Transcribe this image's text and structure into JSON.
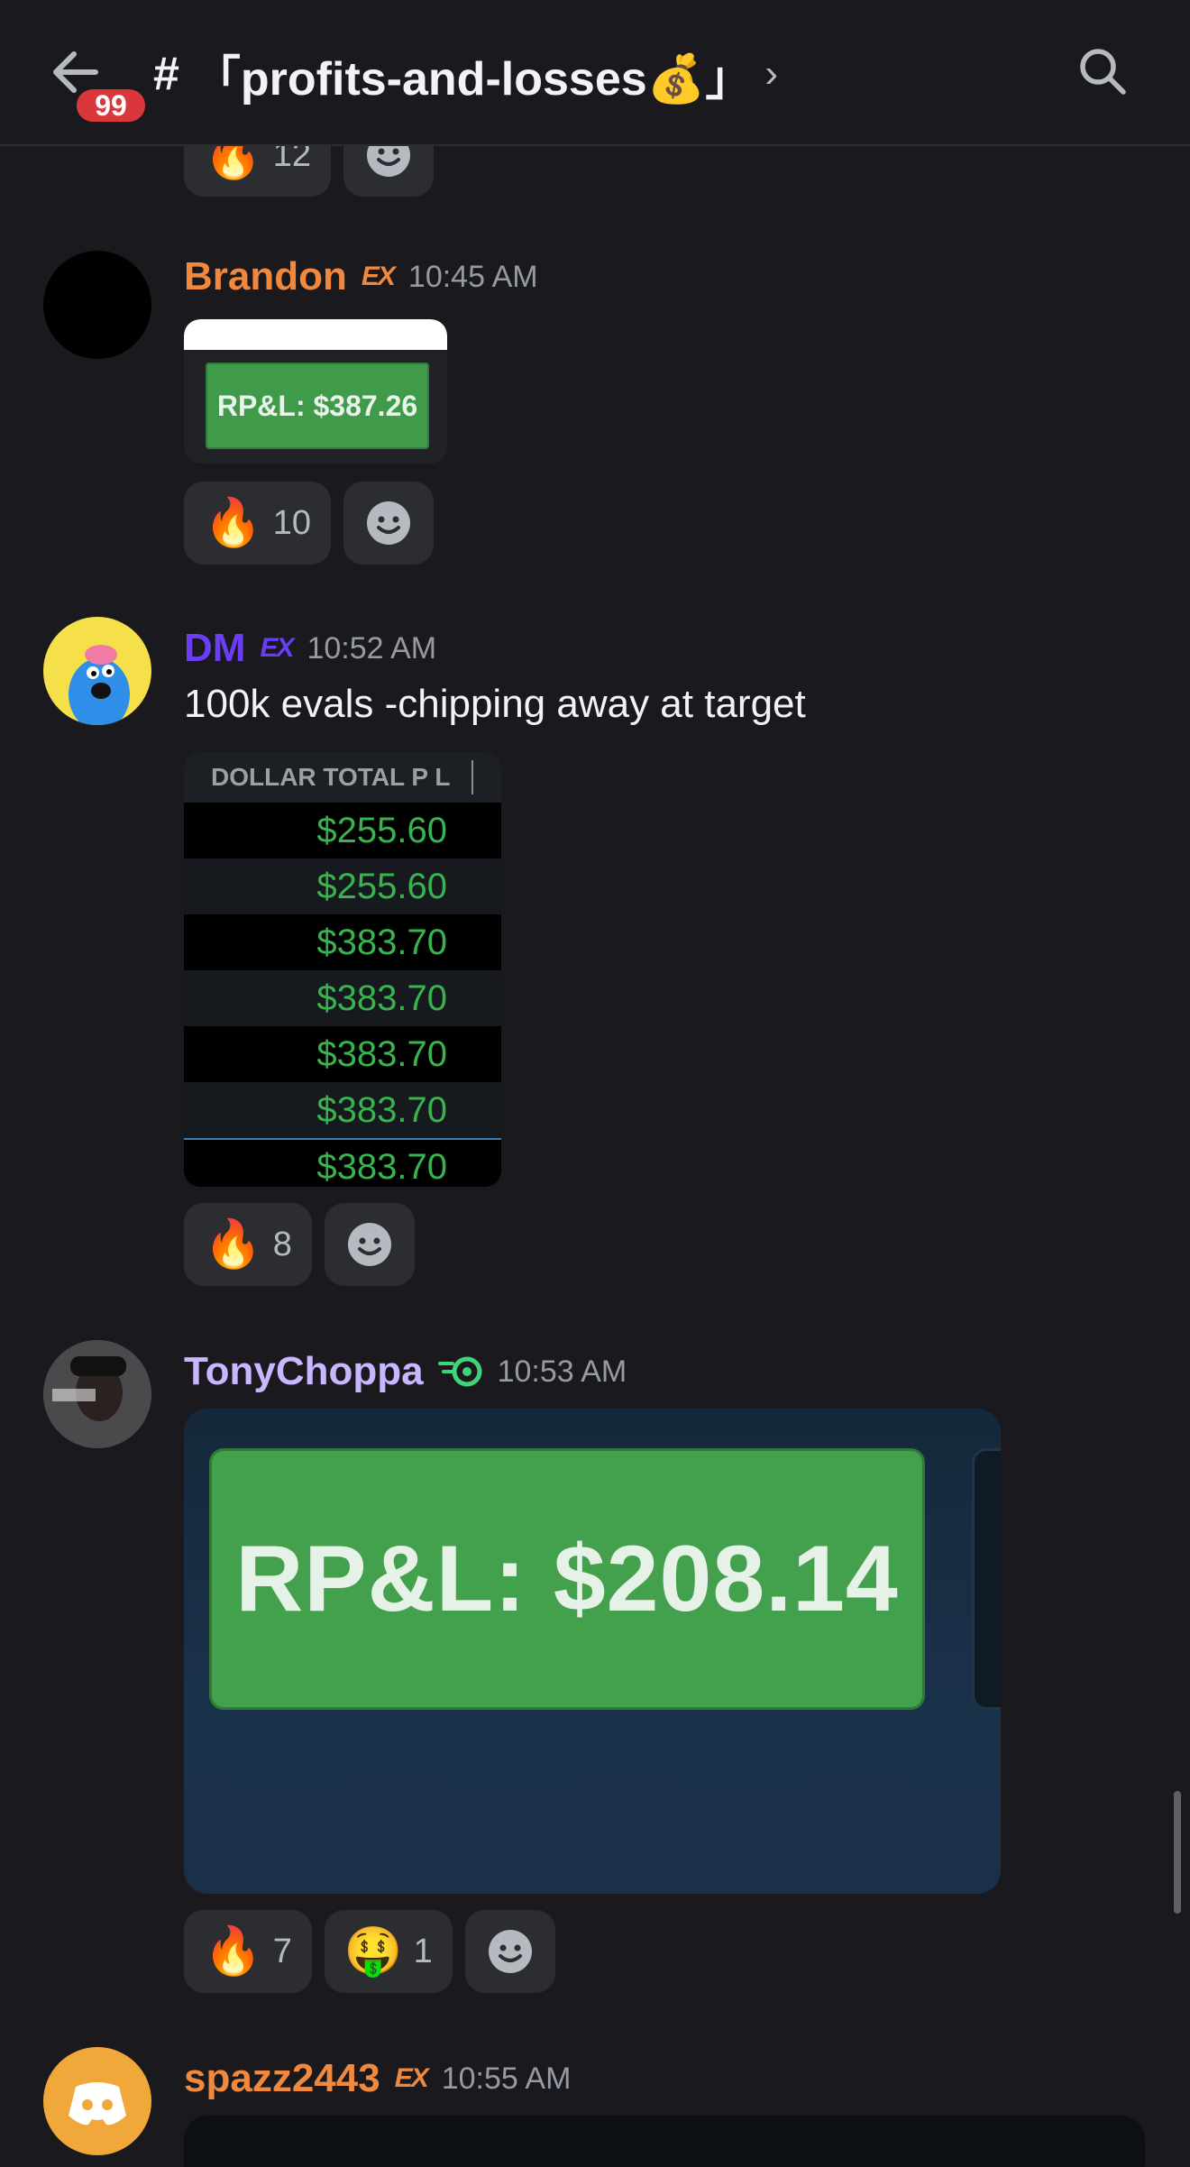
{
  "header": {
    "unread_count": "99",
    "channel_name": "「profits-and-losses💰」",
    "hash": "#"
  },
  "messages": [
    {
      "reactions": [
        {
          "emoji": "🔥",
          "count": "12"
        }
      ]
    },
    {
      "username": "Brandon",
      "username_color": "#f0883e",
      "tag": "EX",
      "time": "10:45 AM",
      "image_text": "RP&L: $387.26",
      "reactions": [
        {
          "emoji": "🔥",
          "count": "10"
        }
      ]
    },
    {
      "username": "DM",
      "username_color": "#6b3df6",
      "tag": "EX",
      "time": "10:52 AM",
      "text": "100k evals -chipping away at target",
      "table": {
        "header": "DOLLAR TOTAL P L",
        "rows": [
          "$255.60",
          "$255.60",
          "$383.70",
          "$383.70",
          "$383.70",
          "$383.70",
          "$383.70"
        ]
      },
      "reactions": [
        {
          "emoji": "🔥",
          "count": "8"
        }
      ]
    },
    {
      "username": "TonyChoppa",
      "username_color": "#c9b6ff",
      "time": "10:53 AM",
      "image_text": "RP&L: $208.14",
      "reactions": [
        {
          "emoji": "🔥",
          "count": "7"
        },
        {
          "emoji": "🤑",
          "count": "1"
        }
      ]
    },
    {
      "username": "spazz2443",
      "username_color": "#f0883e",
      "tag": "EX",
      "time": "10:55 AM"
    }
  ]
}
